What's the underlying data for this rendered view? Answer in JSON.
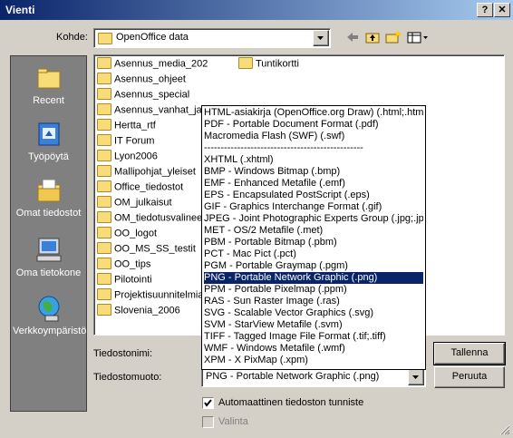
{
  "window": {
    "title": "Vienti",
    "help_label": "?",
    "close_label": "✕"
  },
  "lookin": {
    "label": "Kohde:",
    "value": "OpenOffice data"
  },
  "places": [
    {
      "label": "Recent",
      "icon": "recent-folder-icon"
    },
    {
      "label": "Työpöytä",
      "icon": "desktop-icon"
    },
    {
      "label": "Omat tiedostot",
      "icon": "my-documents-icon"
    },
    {
      "label": "Oma tietokone",
      "icon": "my-computer-icon"
    },
    {
      "label": "Verkkoympäristö",
      "icon": "network-icon"
    }
  ],
  "files_col1": [
    "Asennus_media_202",
    "Asennus_ohjeet",
    "Asennus_special",
    "Asennus_vanhat_ja_",
    "Hertta_rtf",
    "IT Forum",
    "Lyon2006",
    "Mallipohjat_yleiset",
    "Office_tiedostot",
    "OM_julkaisut",
    "OM_tiedotusvalineet",
    "OO_logot",
    "OO_MS_SS_testit",
    "OO_tips",
    "Pilotointi",
    "Projektisuunnitelmia",
    "Slovenia_2006"
  ],
  "files_col2": [
    "Tuntikortti"
  ],
  "filetype_options": [
    "HTML-asiakirja (OpenOffice.org Draw) (.html;.htm)",
    "PDF - Portable Document Format (.pdf)",
    "Macromedia Flash (SWF) (.swf)",
    "------------------------------------------------",
    "XHTML (.xhtml)",
    "BMP - Windows Bitmap (.bmp)",
    "EMF - Enhanced Metafile (.emf)",
    "EPS - Encapsulated PostScript (.eps)",
    "GIF - Graphics Interchange Format (.gif)",
    "JPEG - Joint Photographic Experts Group (.jpg;.jpeg",
    "MET - OS/2 Metafile (.met)",
    "PBM - Portable Bitmap (.pbm)",
    "PCT - Mac Pict (.pct)",
    "PGM - Portable Graymap (.pgm)",
    "PNG - Portable Network Graphic (.png)",
    "PPM - Portable Pixelmap (.ppm)",
    "RAS - Sun Raster Image (.ras)",
    "SVG - Scalable Vector Graphics (.svg)",
    "SVM - StarView Metafile (.svm)",
    "TIFF - Tagged Image File Format (.tif;.tiff)",
    "WMF - Windows Metafile (.wmf)",
    "XPM - X PixMap (.xpm)"
  ],
  "filetype_selected_index": 14,
  "filename": {
    "label": "Tiedostonimi:",
    "value": ""
  },
  "filetype": {
    "label": "Tiedostomuoto:",
    "value": "PNG - Portable Network Graphic (.png)"
  },
  "buttons": {
    "save": "Tallenna",
    "cancel": "Peruuta"
  },
  "checkboxes": {
    "auto_extension": {
      "label": "Automaattinen tiedoston tunniste",
      "checked": true
    },
    "selection": {
      "label": "Valinta",
      "checked": false
    }
  }
}
